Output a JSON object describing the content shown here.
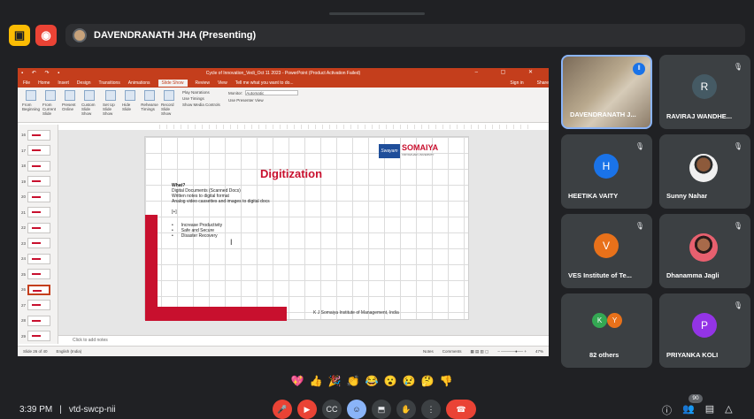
{
  "topbar": {
    "presenter_label": "DAVENDRANATH JHA (Presenting)"
  },
  "ppt": {
    "window_title": "Cycle of Innovation_Vedi_Oct 11 2023 - PowerPoint (Product Activation Failed)",
    "tabs": [
      "File",
      "Home",
      "Insert",
      "Design",
      "Transitions",
      "Animations",
      "Slide Show",
      "Review",
      "View"
    ],
    "active_tab": "Slide Show",
    "tell_me": "Tell me what you want to do...",
    "sign_in": "Sign in",
    "share": "Share",
    "ribbon_items": [
      "From Beginning",
      "From Current Slide",
      "Present Online",
      "Custom Slide Show",
      "Set Up Slide Show",
      "Hide Slide",
      "Rehearse Timings",
      "Record Slide Show"
    ],
    "checks": [
      "Play Narrations",
      "Use Timings",
      "Show Media Controls"
    ],
    "monitor_label": "Monitor:",
    "monitor_value": "Automatic",
    "presenter_view": "Use Presenter View",
    "thumb_numbers": [
      "16",
      "17",
      "18",
      "19",
      "20",
      "21",
      "22",
      "23",
      "24",
      "25",
      "26",
      "27",
      "28",
      "29"
    ],
    "selected_thumb": "26",
    "notes_placeholder": "Click to add notes",
    "status_slide": "Slide 26 of 40",
    "status_lang": "English (India)",
    "status_notes": "Notes",
    "status_comments": "Comments",
    "zoom": "47%"
  },
  "slide": {
    "heading": "Digitization",
    "logo_mark": "Swayam",
    "logo_text": "SOMAIYA",
    "logo_sub": "VIDYAVIHAR UNIVERSITY",
    "what_label": "What?",
    "lines": [
      "Digital Documents (Scanned Docs)",
      "Written notes to digital format",
      "Analog video cassettes and images to digital docs"
    ],
    "why_label": "[+]",
    "bullets": [
      "Increase Productivity",
      "Safe and Secure",
      "Disaster Recovery"
    ],
    "footer": "K J Somaiya Institute of Management, India"
  },
  "participants": [
    {
      "name": "DAVENDRANATH J...",
      "type": "video"
    },
    {
      "name": "RAVIRAJ WANDHE...",
      "initial": "R",
      "color": "#455a64"
    },
    {
      "name": "HEETIKA VAITY",
      "initial": "H",
      "color": "#1a73e8"
    },
    {
      "name": "Sunny Nahar",
      "type": "photo"
    },
    {
      "name": "VES Institute of Te...",
      "initial": "V",
      "color": "#e8711a"
    },
    {
      "name": "Dhanamma Jagli",
      "type": "photo"
    },
    {
      "name": "82 others",
      "initials": [
        "K",
        "Y"
      ]
    },
    {
      "name": "PRIYANKA KOLI",
      "initial": "P",
      "color": "#9334e6"
    }
  ],
  "reactions": [
    "💖",
    "👍",
    "🎉",
    "👏",
    "😂",
    "😮",
    "😢",
    "🤔",
    "👎"
  ],
  "bottombar": {
    "time": "3:39 PM",
    "separator": "|",
    "meeting_code": "vtd-swcp-nii",
    "participant_count": "90"
  },
  "colors": {
    "background": "#202124",
    "ppt_accent": "#c43e1c",
    "slide_red": "#c8102e",
    "end_call": "#ea4335"
  }
}
